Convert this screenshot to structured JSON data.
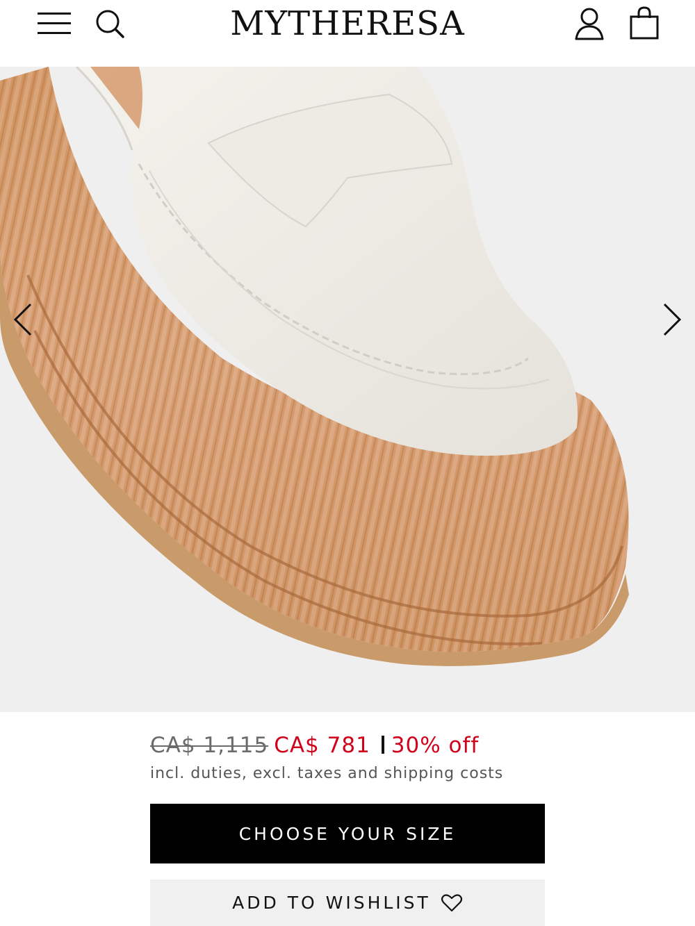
{
  "header": {
    "brand": "MYTHERESA",
    "icons": [
      "menu-icon",
      "search-icon",
      "account-icon",
      "shopping-bag-icon"
    ]
  },
  "gallery": {
    "image_alt": "White leather penny loafer with raffia platform sole",
    "icons": [
      "chevron-left-icon",
      "chevron-right-icon"
    ]
  },
  "pricing": {
    "original_price": "CA$ 1,115",
    "sale_price": "CA$ 781",
    "discount": "30% off",
    "tax_note": "incl. duties, excl. taxes and shipping costs",
    "colors": {
      "sale": "#d0021b",
      "original": "#6b6b6b"
    }
  },
  "actions": {
    "choose_size_label": "CHOOSE YOUR SIZE",
    "wishlist_label": "ADD TO WISHLIST",
    "wishlist_icon": "heart-icon"
  }
}
